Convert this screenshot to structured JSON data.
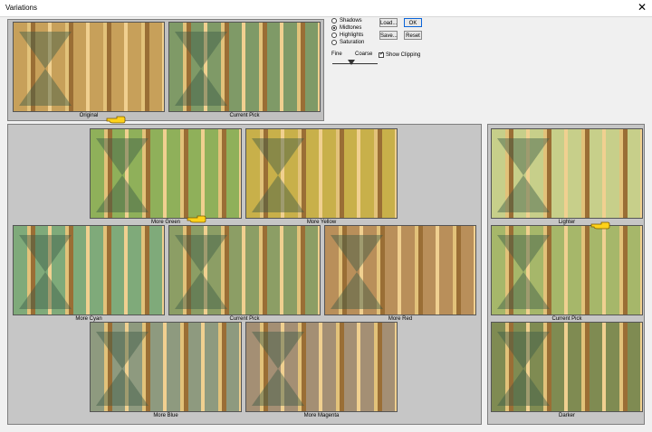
{
  "window": {
    "title": "Variations",
    "close_glyph": "✕"
  },
  "options": {
    "tones": [
      {
        "label": "Shadows",
        "selected": false
      },
      {
        "label": "Midtones",
        "selected": true
      },
      {
        "label": "Highlights",
        "selected": false
      },
      {
        "label": "Saturation",
        "selected": false
      }
    ],
    "fine_label": "Fine",
    "coarse_label": "Coarse",
    "show_clipping_label": "Show Clipping",
    "show_clipping_checked": true
  },
  "buttons": {
    "load": "Load...",
    "ok": "OK",
    "save": "Save...",
    "reset": "Reset"
  },
  "top_previews": [
    {
      "caption": "Original",
      "tint": "#c7a05a"
    },
    {
      "caption": "Current Pick",
      "tint": "#7f9a67"
    }
  ],
  "color_previews": [
    {
      "caption": "More Green",
      "tint": "#8fb05a"
    },
    {
      "caption": "More Yellow",
      "tint": "#c8b04a"
    },
    {
      "caption": "More Cyan",
      "tint": "#7faa7a"
    },
    {
      "caption": "Current Pick",
      "tint": "#8c9e65"
    },
    {
      "caption": "More Red",
      "tint": "#b98f5a"
    },
    {
      "caption": "More Blue",
      "tint": "#8e9a7f"
    },
    {
      "caption": "More Magenta",
      "tint": "#a48f74"
    }
  ],
  "brightness_previews": [
    {
      "caption": "Lighter",
      "tint": "#c7cf8a"
    },
    {
      "caption": "Current Pick",
      "tint": "#a6b76a"
    },
    {
      "caption": "Darker",
      "tint": "#7f8b52"
    }
  ],
  "icons": {
    "pointer": "pointing-hand-icon"
  }
}
